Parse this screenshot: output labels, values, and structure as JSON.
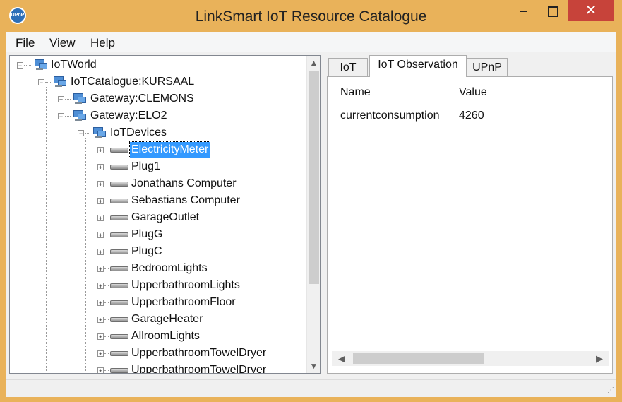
{
  "window": {
    "title": "LinkSmart IoT Resource Catalogue",
    "app_icon_text": "UPnP",
    "accent_color": "#e9b25a",
    "close_color": "#c7433a"
  },
  "menu": {
    "items": [
      "File",
      "View",
      "Help"
    ]
  },
  "tree": {
    "root": "IoTWorld",
    "catalogue": "IoTCatalogue:KURSAAL",
    "gateways": [
      "Gateway:CLEMONS",
      "Gateway:ELO2"
    ],
    "devices_folder": "IoTDevices",
    "selected_device": "ElectricityMeter",
    "devices": [
      "ElectricityMeter",
      "Plug1",
      "Jonathans Computer",
      "Sebastians Computer",
      "GarageOutlet",
      "PlugG",
      "PlugC",
      "BedroomLights",
      "UpperbathroomLights",
      "UpperbathroomFloor",
      "GarageHeater",
      "AllroomLights",
      "UpperbathroomTowelDryer",
      "UpperbathroomTowelDryer"
    ]
  },
  "tabs": {
    "items": [
      "IoT",
      "IoT Observation",
      "UPnP"
    ],
    "active": "IoT Observation"
  },
  "observation": {
    "columns": [
      "Name",
      "Value"
    ],
    "rows": [
      {
        "name": "currentconsumption",
        "value": "4260"
      }
    ]
  }
}
